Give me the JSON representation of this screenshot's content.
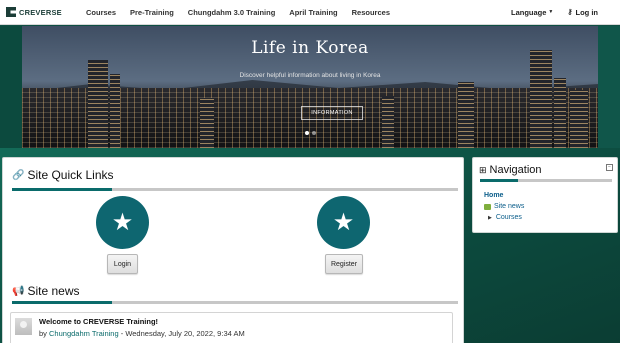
{
  "navbar": {
    "logo_text": "CREVERSE",
    "links": [
      "Courses",
      "Pre-Training",
      "Chungdahm 3.0 Training",
      "April Training",
      "Resources"
    ],
    "language_label": "Language",
    "login_label": "Log in"
  },
  "hero": {
    "title": "Life in Korea",
    "subtitle": "Discover helpful information about living in Korea",
    "button_label": "INFORMATION",
    "slide_count": 2,
    "active_slide": 1
  },
  "quick_links": {
    "title": "Site Quick Links",
    "items": [
      {
        "label": "Login",
        "icon": "star-icon"
      },
      {
        "label": "Register",
        "icon": "star-icon"
      }
    ]
  },
  "site_news": {
    "title": "Site news",
    "items": [
      {
        "title": "Welcome to CREVERSE Training!",
        "by": "by",
        "author": "Chungdahm Training",
        "date": " - Wednesday, July 20, 2022, 9:34 AM"
      }
    ]
  },
  "navigation": {
    "title": "Navigation",
    "home": "Home",
    "site_news": "Site news",
    "courses": "Courses"
  },
  "colors": {
    "accent": "#0a6b6b",
    "circle": "#0e6670",
    "page_bg": "#0f4f43"
  }
}
